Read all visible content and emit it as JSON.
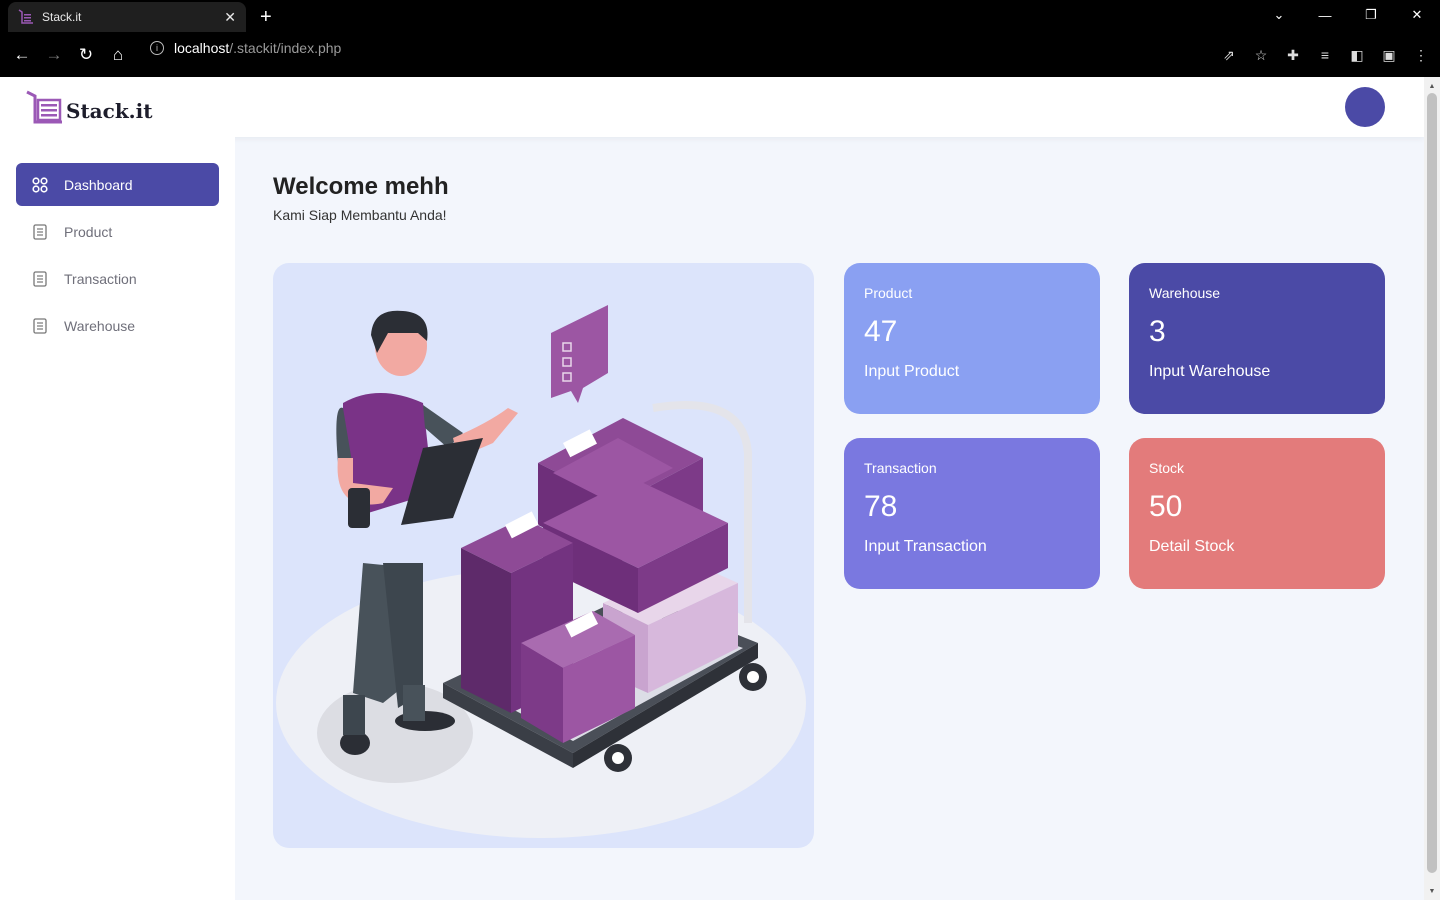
{
  "browser": {
    "tab_title": "Stack.it",
    "url_host": "localhost",
    "url_path": "/.stackit/index.php"
  },
  "app": {
    "logo_text": "Stack.it",
    "welcome": "Welcome mehh",
    "subtitle": "Kami Siap Membantu Anda!",
    "accent_color": "#4b4aa6"
  },
  "sidebar": {
    "items": [
      {
        "label": "Dashboard",
        "icon": "grid-icon",
        "active": true
      },
      {
        "label": "Product",
        "icon": "document-icon",
        "active": false
      },
      {
        "label": "Transaction",
        "icon": "document-icon",
        "active": false
      },
      {
        "label": "Warehouse",
        "icon": "document-icon",
        "active": false
      }
    ]
  },
  "cards": [
    {
      "label": "Product",
      "value": "47",
      "link": "Input Product",
      "color": "#8aa0f2"
    },
    {
      "label": "Warehouse",
      "value": "3",
      "link": "Input Warehouse",
      "color": "#4b4aa6"
    },
    {
      "label": "Transaction",
      "value": "78",
      "link": "Input Transaction",
      "color": "#7a78e0"
    },
    {
      "label": "Stock",
      "value": "50",
      "link": "Detail Stock",
      "color": "#e37b7b"
    }
  ]
}
